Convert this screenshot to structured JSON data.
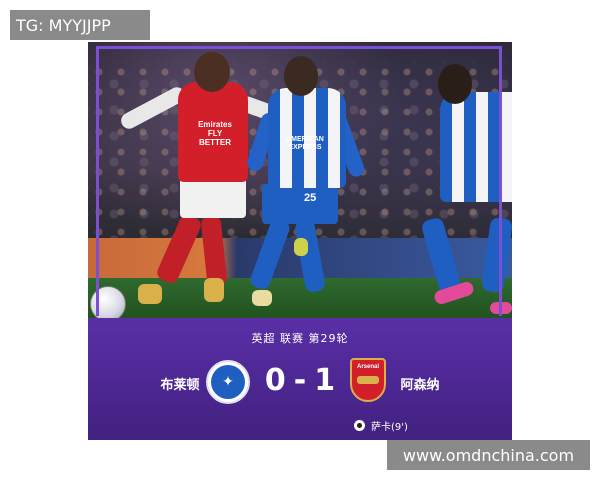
{
  "watermark_top": "TG: MYYJJPP",
  "watermark_bottom": "www.omdnchina.com",
  "photo": {
    "arsenal_shirt_text": "Emirates FLY BETTER",
    "brighton_shirt_text": "AMERICAN EXPRESS",
    "brighton_number": "25"
  },
  "match": {
    "competition": "英超  联赛  第29轮",
    "home_team": "布莱顿",
    "away_team": "阿森纳",
    "home_score": "0",
    "separator": "-",
    "away_score": "1",
    "away_crest_text": "Arsenal",
    "scorer": "萨卡(9')"
  }
}
